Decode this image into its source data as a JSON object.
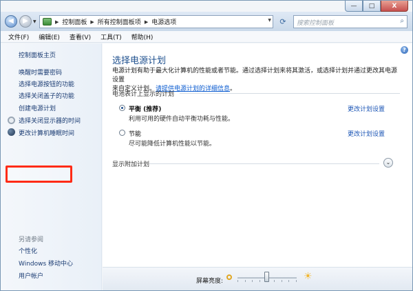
{
  "window": {
    "caption": {
      "minimize": "—",
      "maximize": "□",
      "close": "X"
    }
  },
  "address": {
    "crumbs": [
      "控制面板",
      "所有控制面板项",
      "电源选项"
    ],
    "search_placeholder": "搜索控制面板"
  },
  "menu": [
    "文件(F)",
    "编辑(E)",
    "查看(V)",
    "工具(T)",
    "帮助(H)"
  ],
  "sidebar": {
    "home": "控制面板主页",
    "items": [
      "唤醒时需要密码",
      "选择电源按钮的功能",
      "选择关闭盖子的功能",
      "创建电源计划",
      "选择关闭显示器的时间",
      "更改计算机睡眠时间"
    ],
    "see_also_title": "另请参阅",
    "see_also": [
      "个性化",
      "Windows 移动中心",
      "用户帐户"
    ]
  },
  "main": {
    "title": "选择电源计划",
    "intro_line1": "电源计划有助于最大化计算机的性能或者节能。通过选择计划来将其激活，或选择计划并通过更改其电源设置",
    "intro_line2_prefix": "来自定义计划。",
    "intro_link": "请提供电源计划的详细信息",
    "intro_line2_suffix": "。",
    "battery_section": "电池表计上显示的计划",
    "plans": [
      {
        "name": "平衡 (推荐)",
        "desc": "利用可用的硬件自动平衡功耗与性能。",
        "link": "更改计划设置",
        "selected": true
      },
      {
        "name": "节能",
        "desc": "尽可能降低计算机性能以节能。",
        "link": "更改计划设置",
        "selected": false
      }
    ],
    "more_plans": "显示附加计划"
  },
  "brightness": {
    "label": "屏幕亮度:",
    "level": 0.49
  },
  "colors": {
    "accent": "#1d4f8e",
    "link": "#1b55b5",
    "highlight": "#ff2b16"
  }
}
